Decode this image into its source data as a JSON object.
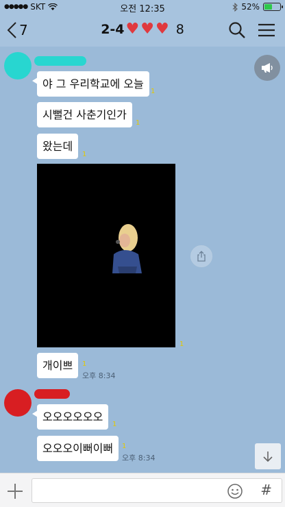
{
  "status_bar": {
    "carrier": "SKT",
    "time": "오전 12:35",
    "battery": "52%",
    "battery_level": 0.52
  },
  "header": {
    "back_count": "7",
    "title": "2-4",
    "member_count": "8"
  },
  "messages": [
    {
      "text": "야 그 우리학교에 오늘",
      "unread": "1"
    },
    {
      "text": "시뻘건 사춘기인가",
      "unread": "1"
    },
    {
      "text": "왔는데",
      "unread": "1"
    },
    {
      "unread": "1"
    },
    {
      "text": "개이쁘",
      "unread": "1",
      "time": "오후 8:34"
    },
    {
      "text": "오오오오오오",
      "unread": "1"
    },
    {
      "text": "오오오이뻐이뻐",
      "unread": "1",
      "time": "오후 8:34"
    }
  ],
  "colors": {
    "background": "#9bbad8",
    "avatar_1": "#28d6d0",
    "avatar_2": "#d81e22",
    "unread": "#e3c800"
  },
  "icons": {
    "back": "chevron-left-icon",
    "search": "search-icon",
    "menu": "menu-icon",
    "announce": "megaphone-icon",
    "share": "share-icon",
    "scroll_down": "arrow-down-icon",
    "add": "plus-icon",
    "emoji": "emoji-icon",
    "hashtag": "hashtag-icon"
  }
}
